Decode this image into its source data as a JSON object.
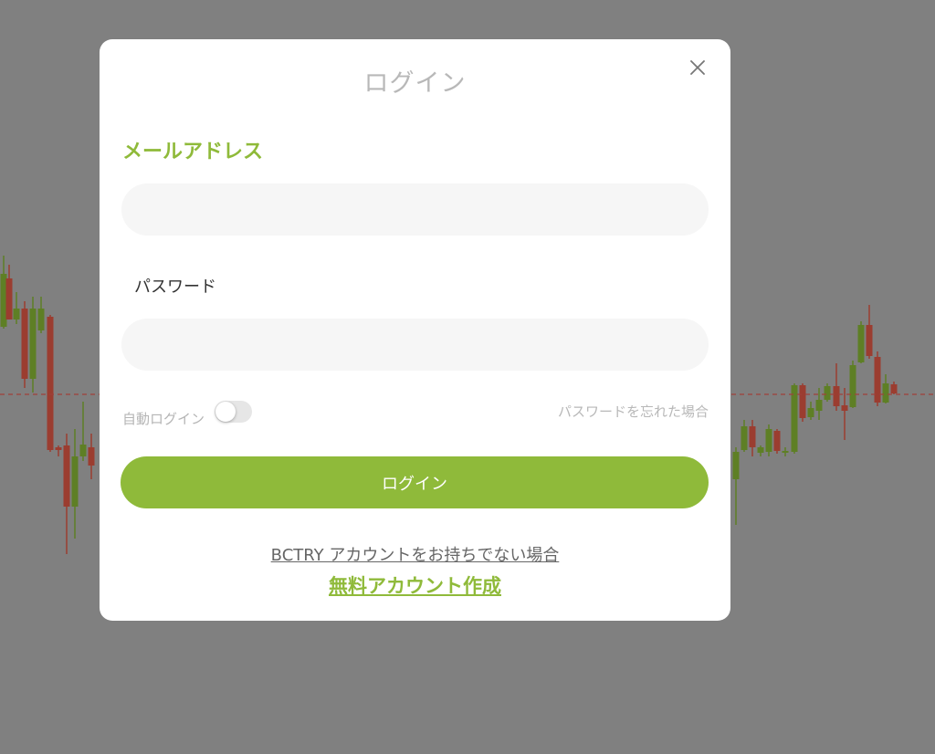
{
  "colors": {
    "overlay": "#808080",
    "accent_green": "#8fba3a",
    "candle_up": "#5e7f25",
    "candle_down": "#9b3d30",
    "price_line": "#a0403a"
  },
  "login_modal": {
    "title": "ログイン",
    "close_icon": "close-icon",
    "email_label": "メールアドレス",
    "email_value": "",
    "password_label": "パスワード",
    "password_value": "",
    "auto_login_label": "自動ログイン",
    "auto_login_enabled": false,
    "forgot_password": "パスワードを忘れた場合",
    "login_button": "ログイン",
    "no_account_text": "BCTRY アカウントをお持ちでない場合",
    "signup_link": "無料アカウント作成"
  }
}
